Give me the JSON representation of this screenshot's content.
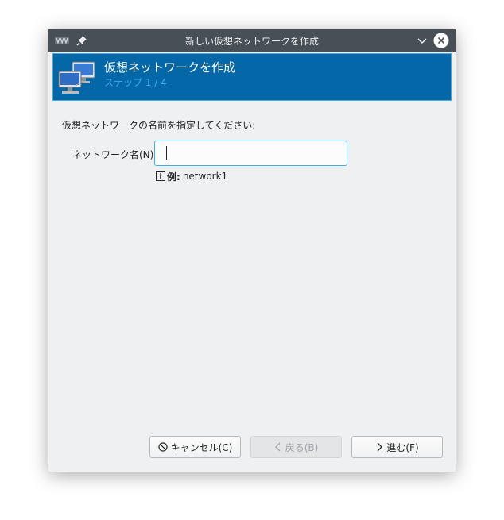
{
  "window": {
    "title": "新しい仮想ネットワークを作成"
  },
  "banner": {
    "title": "仮想ネットワークを作成",
    "step": "ステップ 1 / 4"
  },
  "form": {
    "prompt": "仮想ネットワークの名前を指定してください:",
    "name_label": "ネットワーク名(N):",
    "name_value": "",
    "hint_prefix": "例:",
    "hint_text": "network1"
  },
  "buttons": {
    "cancel": "キャンセル(C)",
    "back": "戻る(B)",
    "next": "進む(F)"
  },
  "icons": {
    "app": "virt-manager-icon",
    "pin": "pin-icon",
    "minimize": "chevron-down-icon",
    "close": "close-icon",
    "banner": "network-computers-icon",
    "hint": "info-icon",
    "cancel": "cancel-icon",
    "back": "chevron-left-icon",
    "next": "chevron-right-icon"
  },
  "colors": {
    "titlebar": "#475057",
    "banner_bg": "#0468a8",
    "accent": "#3daee9",
    "window_bg": "#eff0f1"
  }
}
